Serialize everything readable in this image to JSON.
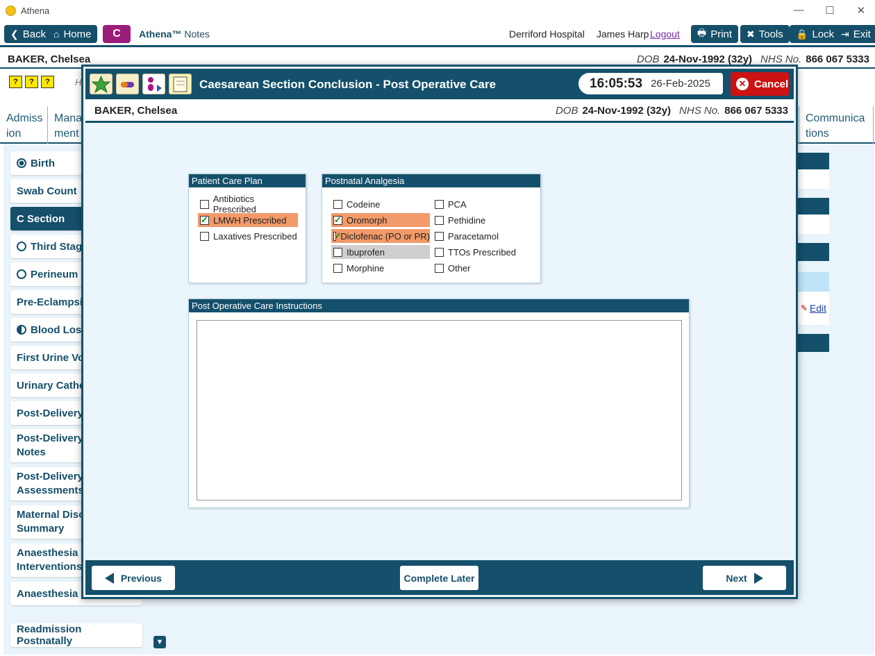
{
  "window": {
    "title": "Athena",
    "minimize": "—",
    "maximize": "☐",
    "close": "✕"
  },
  "toolbar": {
    "back": "Back",
    "home": "Home",
    "module_badge": "C",
    "brand_name": "Athena™",
    "brand_sub": "Notes",
    "hospital": "Derriford Hospital",
    "user": "James Harp",
    "logout": "Logout",
    "print": "Print",
    "tools": "Tools",
    "lock": "Lock",
    "exit": "Exit"
  },
  "patient": {
    "name": "BAKER, Chelsea",
    "dob_label": "DOB",
    "dob": "24-Nov-1992 (32y)",
    "nhs_label": "NHS No.",
    "nhs": "866 067 5333"
  },
  "help_icons": [
    "?",
    "?",
    "?"
  ],
  "hidden_text": "H",
  "tabs": [
    {
      "label": "Admiss ion"
    },
    {
      "label": "Mana ment"
    },
    {
      "label": "Communica tions"
    }
  ],
  "left_nav": [
    {
      "label": "Birth",
      "radio": "filled"
    },
    {
      "label": "Swab Count"
    },
    {
      "label": "C Section",
      "active": true
    },
    {
      "label": "Third Stage",
      "radio": "empty"
    },
    {
      "label": "Perineum",
      "radio": "empty"
    },
    {
      "label": "Pre-Eclampsia"
    },
    {
      "label": "Blood Loss",
      "radio": "half"
    },
    {
      "label": "First Urine Voi"
    },
    {
      "label": "Urinary Cathe"
    },
    {
      "label": "Post-Delivery"
    },
    {
      "label": "Post-Delivery Notes"
    },
    {
      "label": "Post-Delivery Assessments"
    },
    {
      "label": "Maternal Disc Summary"
    },
    {
      "label": "Anaesthesia Interventions"
    },
    {
      "label": "Anaesthesia Fo"
    },
    {
      "label": "Readmission Postnatally"
    }
  ],
  "right_edit": "Edit",
  "modal": {
    "title": "Caesarean Section Conclusion - Post Operative Care",
    "time": "16:05:53",
    "date": "26-Feb-2025",
    "cancel": "Cancel",
    "care_plan": {
      "title": "Patient Care Plan",
      "items": [
        {
          "label": "Antibiotics Prescribed",
          "checked": false
        },
        {
          "label": "LMWH Prescribed",
          "checked": true
        },
        {
          "label": "Laxatives Prescribed",
          "checked": false
        }
      ]
    },
    "analgesia": {
      "title": "Postnatal Analgesia",
      "col1": [
        {
          "label": "Codeine",
          "checked": false
        },
        {
          "label": "Oromorph",
          "checked": true
        },
        {
          "label": "Diclofenac (PO or PR)",
          "checked": true
        },
        {
          "label": "Ibuprofen",
          "checked": false
        },
        {
          "label": "Morphine",
          "checked": false
        }
      ],
      "col2": [
        {
          "label": "PCA",
          "checked": false
        },
        {
          "label": "Pethidine",
          "checked": false
        },
        {
          "label": "Paracetamol",
          "checked": false
        },
        {
          "label": "TTOs Prescribed",
          "checked": false
        },
        {
          "label": "Other",
          "checked": false
        }
      ]
    },
    "instructions": {
      "title": "Post Operative Care Instructions",
      "value": ""
    },
    "footer": {
      "previous": "Previous",
      "complete_later": "Complete Later",
      "next": "Next"
    }
  },
  "colors": {
    "primary": "#14506b",
    "highlight": "#f29a6a",
    "cancel": "#cc1212",
    "badge": "#9c1c7a"
  }
}
